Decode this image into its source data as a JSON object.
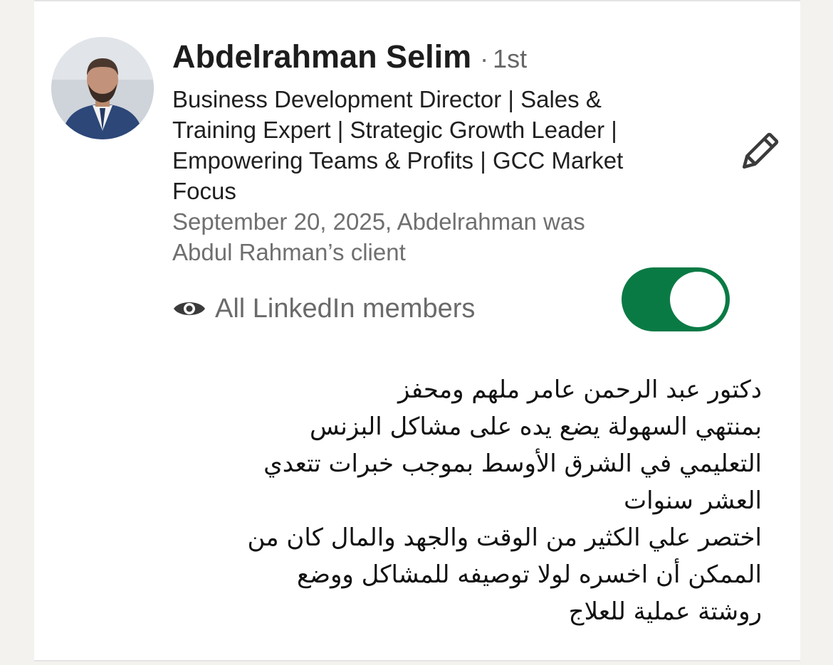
{
  "recommendation": {
    "author": {
      "name": "Abdelrahman Selim",
      "connection_separator": "·",
      "connection_degree": "1st",
      "avatar_icon": "person-avatar"
    },
    "headline_lines": [
      "Business Development Director | Sales &",
      "Training Expert | Strategic Growth Leader |",
      "Empowering Teams & Profits | GCC Market",
      "Focus"
    ],
    "relationship_lines": [
      "September 20, 2025, Abdelrahman was",
      "Abdul Rahman’s client"
    ],
    "edit_icon": "pencil-icon",
    "visibility": {
      "icon": "eye-icon",
      "label": "All LinkedIn members"
    },
    "toggle": {
      "on": true,
      "color": "#0a7a45"
    },
    "text_lines": [
      "دكتور عبد الرحمن عامر ملهم ومحفز",
      "بمنتهي السهولة يضع يده على مشاكل البزنس",
      "التعليمي في الشرق الأوسط بموجب خبرات تتعدي",
      "العشر سنوات",
      "اختصر علي الكثير من الوقت والجهد والمال كان من",
      "الممكن أن اخسره لولا توصيفه للمشاكل ووضع",
      "روشتة عملية للعلاج"
    ]
  }
}
